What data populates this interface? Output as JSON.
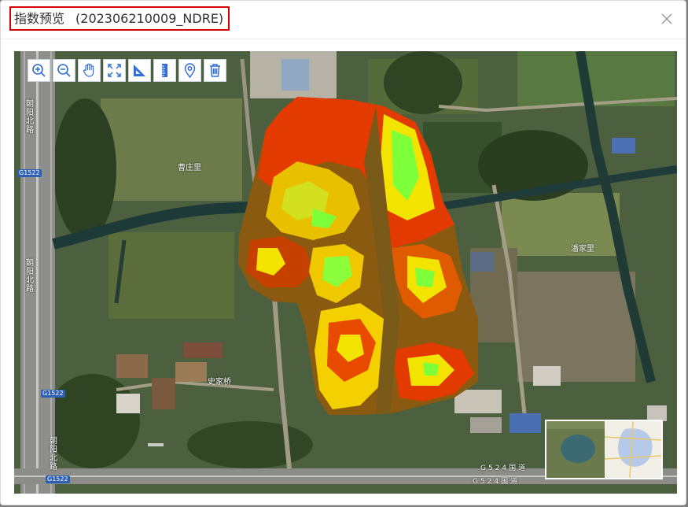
{
  "dialog": {
    "title": "指数预览",
    "title_code": "(202306210009_NDRE)"
  },
  "toolbar": {
    "tools": [
      {
        "name": "zoom-in-icon"
      },
      {
        "name": "zoom-out-icon"
      },
      {
        "name": "pan-hand-icon"
      },
      {
        "name": "full-extent-icon"
      },
      {
        "name": "measure-area-icon"
      },
      {
        "name": "measure-distance-icon"
      },
      {
        "name": "location-marker-icon"
      },
      {
        "name": "clear-trash-icon"
      }
    ]
  },
  "map": {
    "place_labels": {
      "village_1": "曹庄里",
      "village_2": "潘家里",
      "village_3": "史家桥"
    },
    "road_labels": {
      "left_top": "朝阳北路",
      "left_middle": "朝阳北路",
      "left_bottom": "朝阳北路",
      "shield_1": "G1522",
      "shield_2": "G1522",
      "shield_3": "G1522",
      "g524_1": "G524国道",
      "g524_2": "G524国道"
    }
  },
  "colors": {
    "title_border": "#d40000",
    "tool_icon": "#2f6fd6",
    "ndre_high": "#7dff3a",
    "ndre_mid": "#f2e400",
    "ndre_low": "#e23a00",
    "ndre_bg": "#8a5a10"
  }
}
